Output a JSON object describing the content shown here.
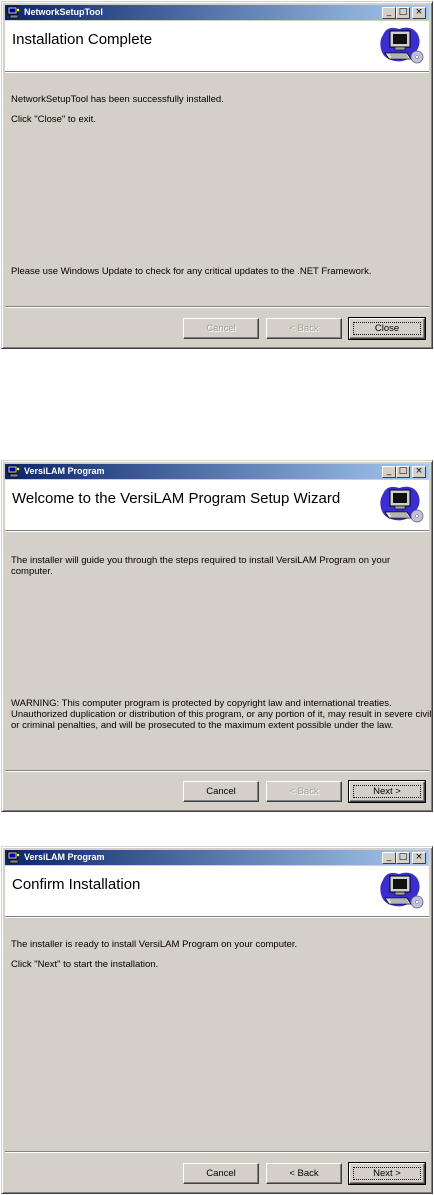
{
  "windows": [
    {
      "id": "network-setup-tool",
      "title": "NetworkSetupTool",
      "banner_title": "Installation Complete",
      "lines": [
        "NetworkSetupTool has been successfully installed.",
        "Click \"Close\" to exit.",
        "Please use Windows Update to check for any critical updates to the .NET Framework."
      ],
      "buttons": {
        "cancel": "Cancel",
        "back": "< Back",
        "primary": "Close"
      },
      "states": {
        "cancel": "disabled",
        "back": "disabled",
        "primary": "default"
      }
    },
    {
      "id": "versilam-welcome",
      "title": "VersiLAM Program",
      "banner_title": "Welcome to the VersiLAM Program Setup Wizard",
      "lines": [
        "The installer will guide you through the steps required to install VersiLAM Program on your computer.",
        "WARNING: This computer program is protected by copyright law and international treaties.",
        "Unauthorized duplication or distribution of this program, or any portion of it, may result in severe civil",
        "or criminal penalties, and will be prosecuted to the maximum extent possible under the law."
      ],
      "buttons": {
        "cancel": "Cancel",
        "back": "< Back",
        "primary": "Next >"
      },
      "states": {
        "cancel": "enabled",
        "back": "disabled",
        "primary": "default"
      }
    },
    {
      "id": "versilam-confirm",
      "title": "VersiLAM Program",
      "banner_title": "Confirm Installation",
      "lines": [
        "The installer is ready to install VersiLAM Program on your computer.",
        "Click \"Next\" to start the installation."
      ],
      "buttons": {
        "cancel": "Cancel",
        "back": "< Back",
        "primary": "Next >"
      },
      "states": {
        "cancel": "enabled",
        "back": "enabled",
        "primary": "default"
      }
    }
  ],
  "caption_buttons": {
    "minimize": "_",
    "maximize": "□",
    "close": "×"
  },
  "icons": {
    "titlebar": "setup-icon",
    "banner": "computer-setup-icon"
  },
  "colors": {
    "titlebar_start": "#0a246a",
    "titlebar_end": "#a6caf0",
    "dialog_bg": "#d4d0c8"
  }
}
